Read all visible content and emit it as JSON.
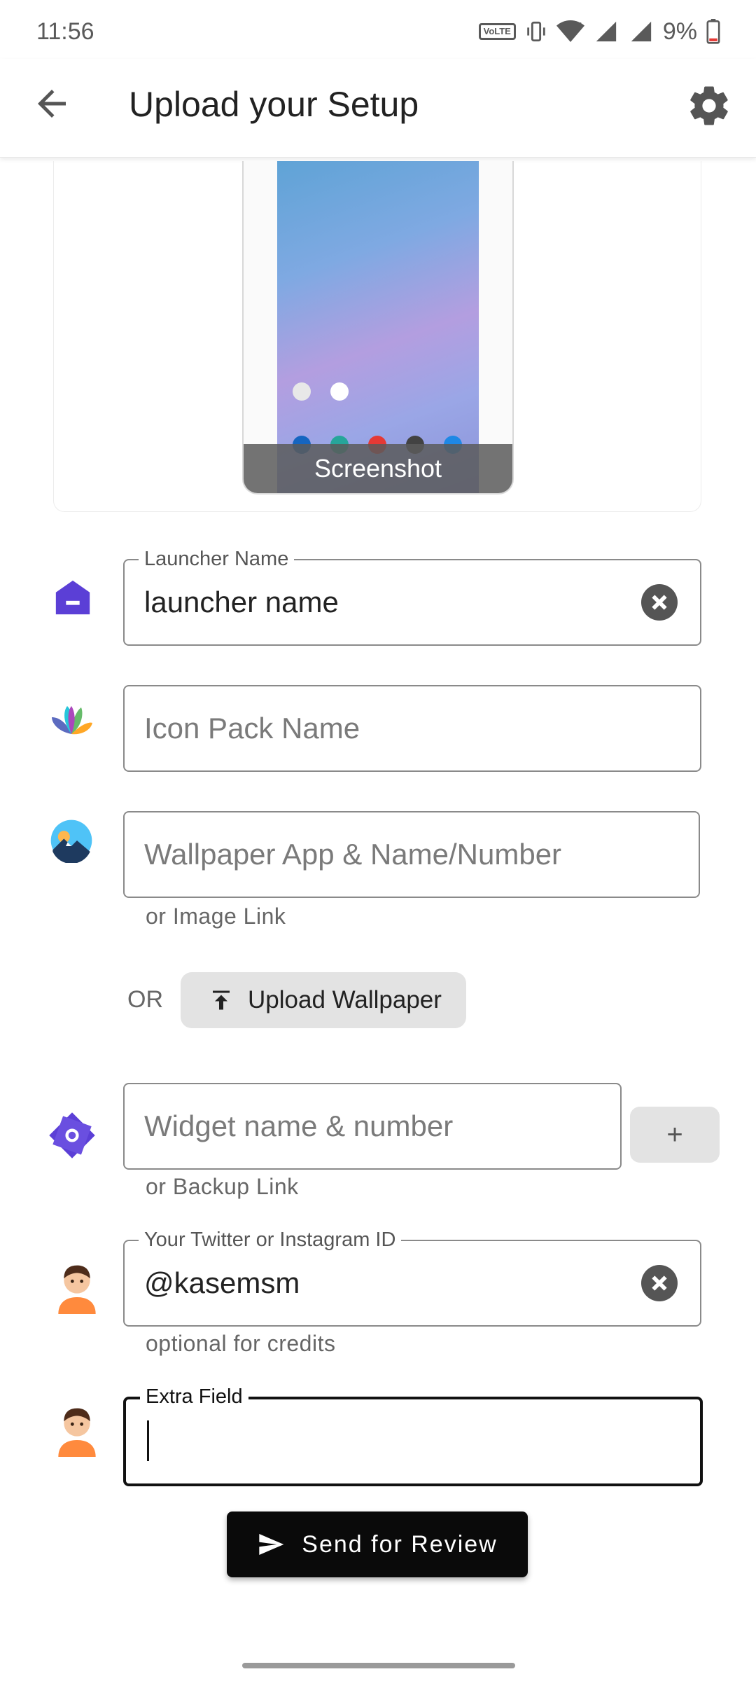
{
  "status_bar": {
    "time": "11:56",
    "volte_label": "Vo) 1 WiFi2",
    "battery": "9%"
  },
  "app_bar": {
    "title": "Upload your Setup"
  },
  "screenshot_card": {
    "label": "Screenshot"
  },
  "form": {
    "launcher": {
      "label": "Launcher Name",
      "value": "launcher name"
    },
    "icon_pack": {
      "placeholder": "Icon Pack Name"
    },
    "wallpaper": {
      "placeholder": "Wallpaper App & Name/Number",
      "helper": "or Image Link"
    },
    "or_text": "OR",
    "upload_wallpaper_label": "Upload Wallpaper",
    "widget": {
      "placeholder": "Widget name & number",
      "helper": "or Backup Link",
      "add_label": "+"
    },
    "social": {
      "label": "Your Twitter or Instagram ID",
      "value": "@kasemsm",
      "helper": "optional for credits"
    },
    "extra": {
      "label": "Extra Field",
      "value": ""
    }
  },
  "send_button_label": "Send for Review",
  "icons": {
    "back": "arrow-left-icon",
    "settings": "gear-icon",
    "launcher": "home-icon",
    "icon_pack": "fan-leaves-icon",
    "wallpaper": "landscape-icon",
    "widget": "widget-icon",
    "avatar": "person-avatar-icon",
    "clear": "clear-circle-icon",
    "upload": "upload-arrow-icon",
    "send": "send-icon"
  },
  "colors": {
    "accent_purple": "#5b3fd6",
    "button_dark": "#0a0a0a",
    "button_grey": "#e3e3e3"
  }
}
